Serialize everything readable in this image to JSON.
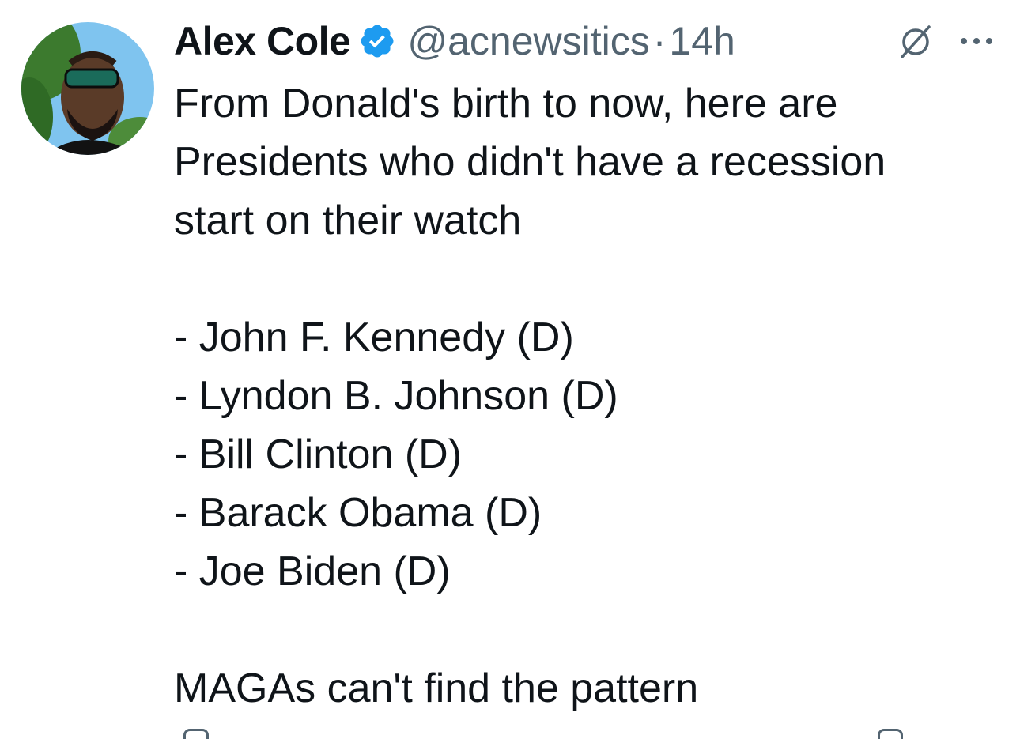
{
  "tweet": {
    "author": {
      "display_name": "Alex Cole",
      "handle": "@acnewsitics",
      "verified": true
    },
    "separator": "·",
    "time": "14h",
    "intro_lines": [
      "From Donald's birth to now, here are",
      "Presidents who didn't have a recession",
      "start on their watch"
    ],
    "list_items": [
      "- John F. Kennedy (D)",
      "- Lyndon B. Johnson (D)",
      "- Bill Clinton (D)",
      "- Barack Obama (D)",
      "- Joe Biden (D)"
    ],
    "closing": "MAGAs can't find the pattern"
  },
  "icons": {
    "verified": "verified-badge-icon",
    "grok": "grok-icon",
    "more": "more-options-icon"
  },
  "colors": {
    "text_primary": "#0f1419",
    "text_secondary": "#536471",
    "verified_blue": "#1d9bf0"
  }
}
